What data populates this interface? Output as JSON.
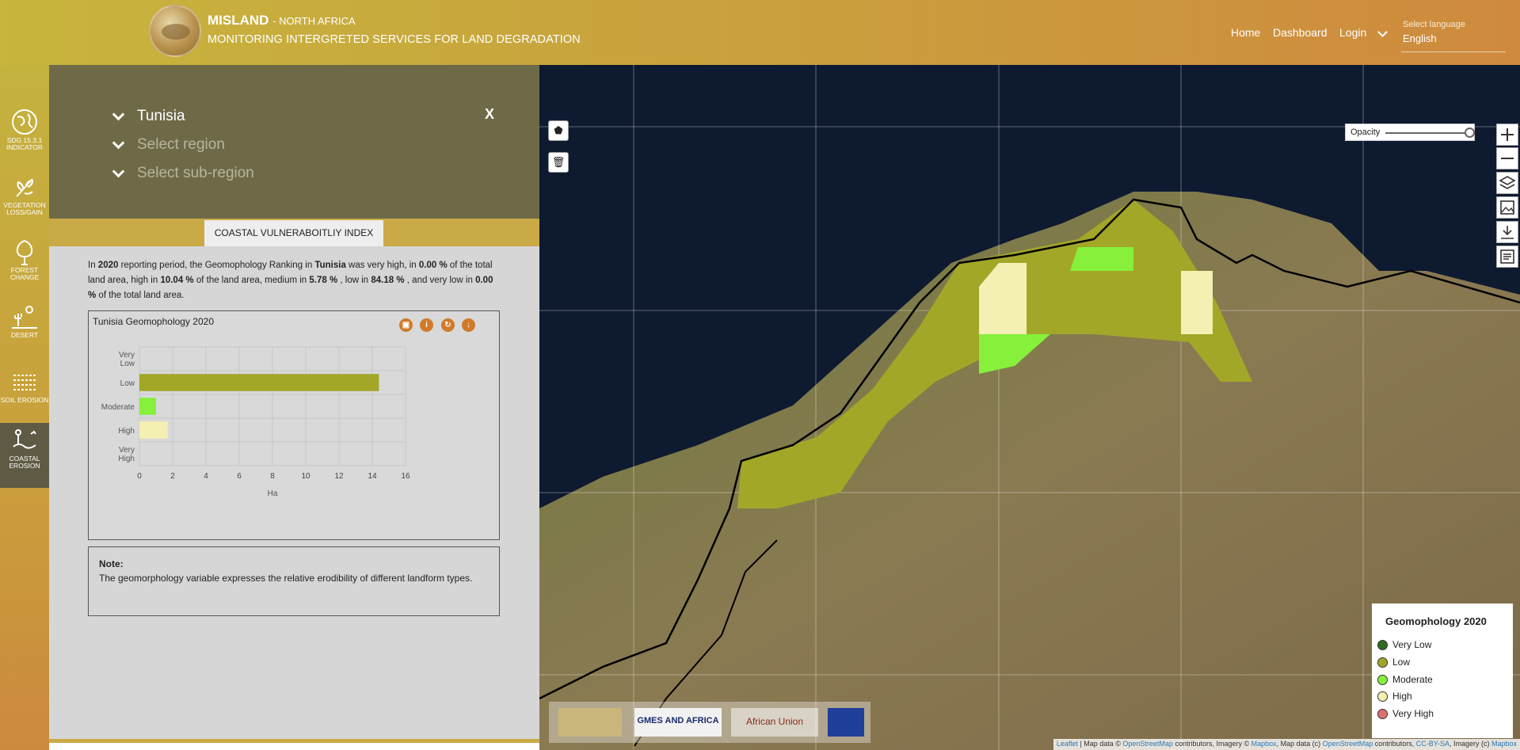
{
  "header": {
    "brand": "MISLAND",
    "brand_suffix": "- NORTH AFRICA",
    "subtitle": "MONITORING INTERGRETED SERVICES FOR LAND DEGRADATION",
    "nav": [
      "Home",
      "Dashboard",
      "Login"
    ],
    "language_label": "Select language",
    "language_value": "English"
  },
  "sidebar": {
    "items": [
      {
        "label": "SDG 15.3.1 INDICATOR",
        "icon": "globe-icon"
      },
      {
        "label": "VEGETATION LOSS/GAIN",
        "icon": "leaf-icon"
      },
      {
        "label": "FOREST CHANGE",
        "icon": "tree-icon"
      },
      {
        "label": "DESERT",
        "icon": "desert-icon"
      },
      {
        "label": "SOIL EROSION",
        "icon": "soil-icon"
      },
      {
        "label": "COASTAL EROSION",
        "icon": "coastal-icon",
        "active": true
      }
    ]
  },
  "selectors": {
    "country": "Tunisia",
    "region_placeholder": "Select region",
    "subregion_placeholder": "Select sub-region",
    "close_label": "X"
  },
  "panel": {
    "tab_label": "COASTAL VULNERABOITLIY INDEX",
    "description": {
      "p1": "In ",
      "year": "2020",
      "p2": " reporting period, the Geomophology Ranking in ",
      "country": "Tunisia",
      "p3": " was very high, in ",
      "v_very_high": "0.00 %",
      "p4": " of the total land area, high in ",
      "v_high": "10.04 %",
      "p5": " of the land area, medium in ",
      "v_medium": "5.78 %",
      "p6": " , low in ",
      "v_low": "84.18 %",
      "p7": " , and very low in ",
      "v_very_low": "0.00 %",
      "p8": " of the total land area."
    },
    "note_title": "Note:",
    "note_text": "The geomorphology variable expresses the relative erodibility of different landform types."
  },
  "chart_data": {
    "type": "bar",
    "orientation": "horizontal",
    "title": "Tunisia Geomophology 2020",
    "categories": [
      "Very Low",
      "Low",
      "Moderate",
      "High",
      "Very High"
    ],
    "values": [
      0,
      14.4,
      1.0,
      1.7,
      0
    ],
    "colors": [
      "#2f6b1f",
      "#a2a728",
      "#86f03a",
      "#f4efb2",
      "#e07070"
    ],
    "xlabel": "Ha",
    "ylabel": "",
    "xlim": [
      0,
      16
    ],
    "xticks": [
      0,
      2,
      4,
      6,
      8,
      10,
      12,
      14,
      16
    ],
    "grid": true
  },
  "map": {
    "opacity_label": "Opacity",
    "opacity_value": 1.0,
    "legend": {
      "title": "Geomophology 2020",
      "items": [
        {
          "label": "Very Low",
          "color": "#2f6b1f"
        },
        {
          "label": "Low",
          "color": "#a2a728"
        },
        {
          "label": "Moderate",
          "color": "#86f03a"
        },
        {
          "label": "High",
          "color": "#f4efb2"
        },
        {
          "label": "Very High",
          "color": "#e07070"
        }
      ]
    },
    "attribution": {
      "leaflet": "Leaflet",
      "t1": " | Map data © ",
      "osm": "OpenStreetMap",
      "t2": " contributors, Imagery © ",
      "mapbox": "Mapbox",
      "t3": ", Map data (c) ",
      "osm2": "OpenStreetMap",
      "t4": " contributors, ",
      "cc": "CC-BY-SA",
      "t5": ", Imagery (c) ",
      "mapbox2": "Mapbox"
    },
    "partners": [
      "GMES AND AFRICA",
      "African Union"
    ]
  }
}
